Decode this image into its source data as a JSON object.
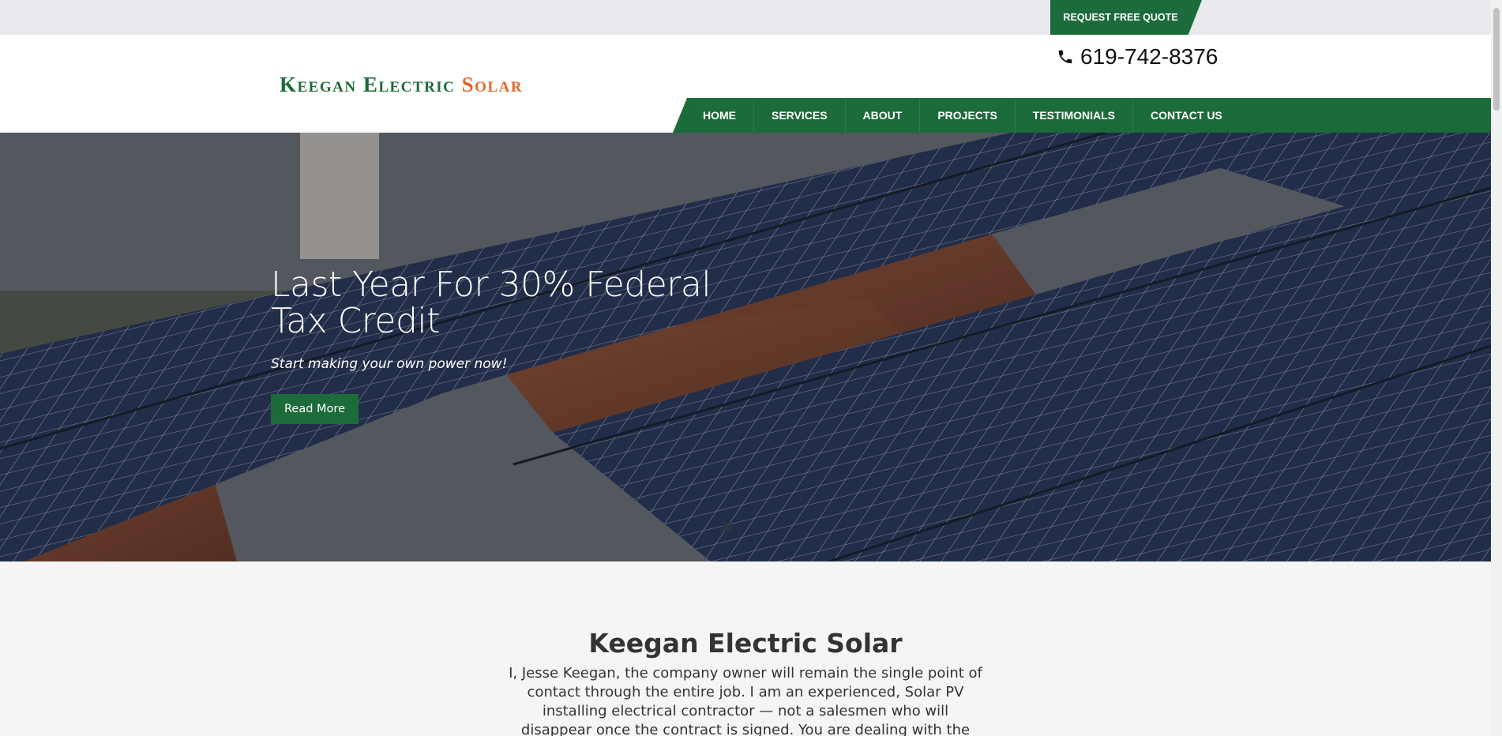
{
  "topbar": {
    "quote_label": "REQUEST FREE QUOTE"
  },
  "header": {
    "logo_part1": "Keegan Electric ",
    "logo_part2": "Solar",
    "phone": "619-742-8376"
  },
  "nav": {
    "items": [
      {
        "label": "HOME"
      },
      {
        "label": "SERVICES"
      },
      {
        "label": "ABOUT"
      },
      {
        "label": "PROJECTS"
      },
      {
        "label": "TESTIMONIALS"
      },
      {
        "label": "CONTACT US"
      }
    ]
  },
  "hero": {
    "title": "Last Year For 30% Federal Tax Credit",
    "subtitle": "Start making your own power now!",
    "button_label": "Read More"
  },
  "about": {
    "heading": "Keegan Electric Solar",
    "body": "I, Jesse Keegan, the company owner will remain the single point of contact through the entire job. I am an experienced, Solar PV installing electrical contractor — not a salesmen who will disappear once the contract is signed.  You are dealing with the company owner, not an"
  },
  "colors": {
    "brand_green": "#1c6b3a",
    "accent_orange": "#e8672a"
  },
  "icons": {
    "phone": "phone-icon"
  }
}
